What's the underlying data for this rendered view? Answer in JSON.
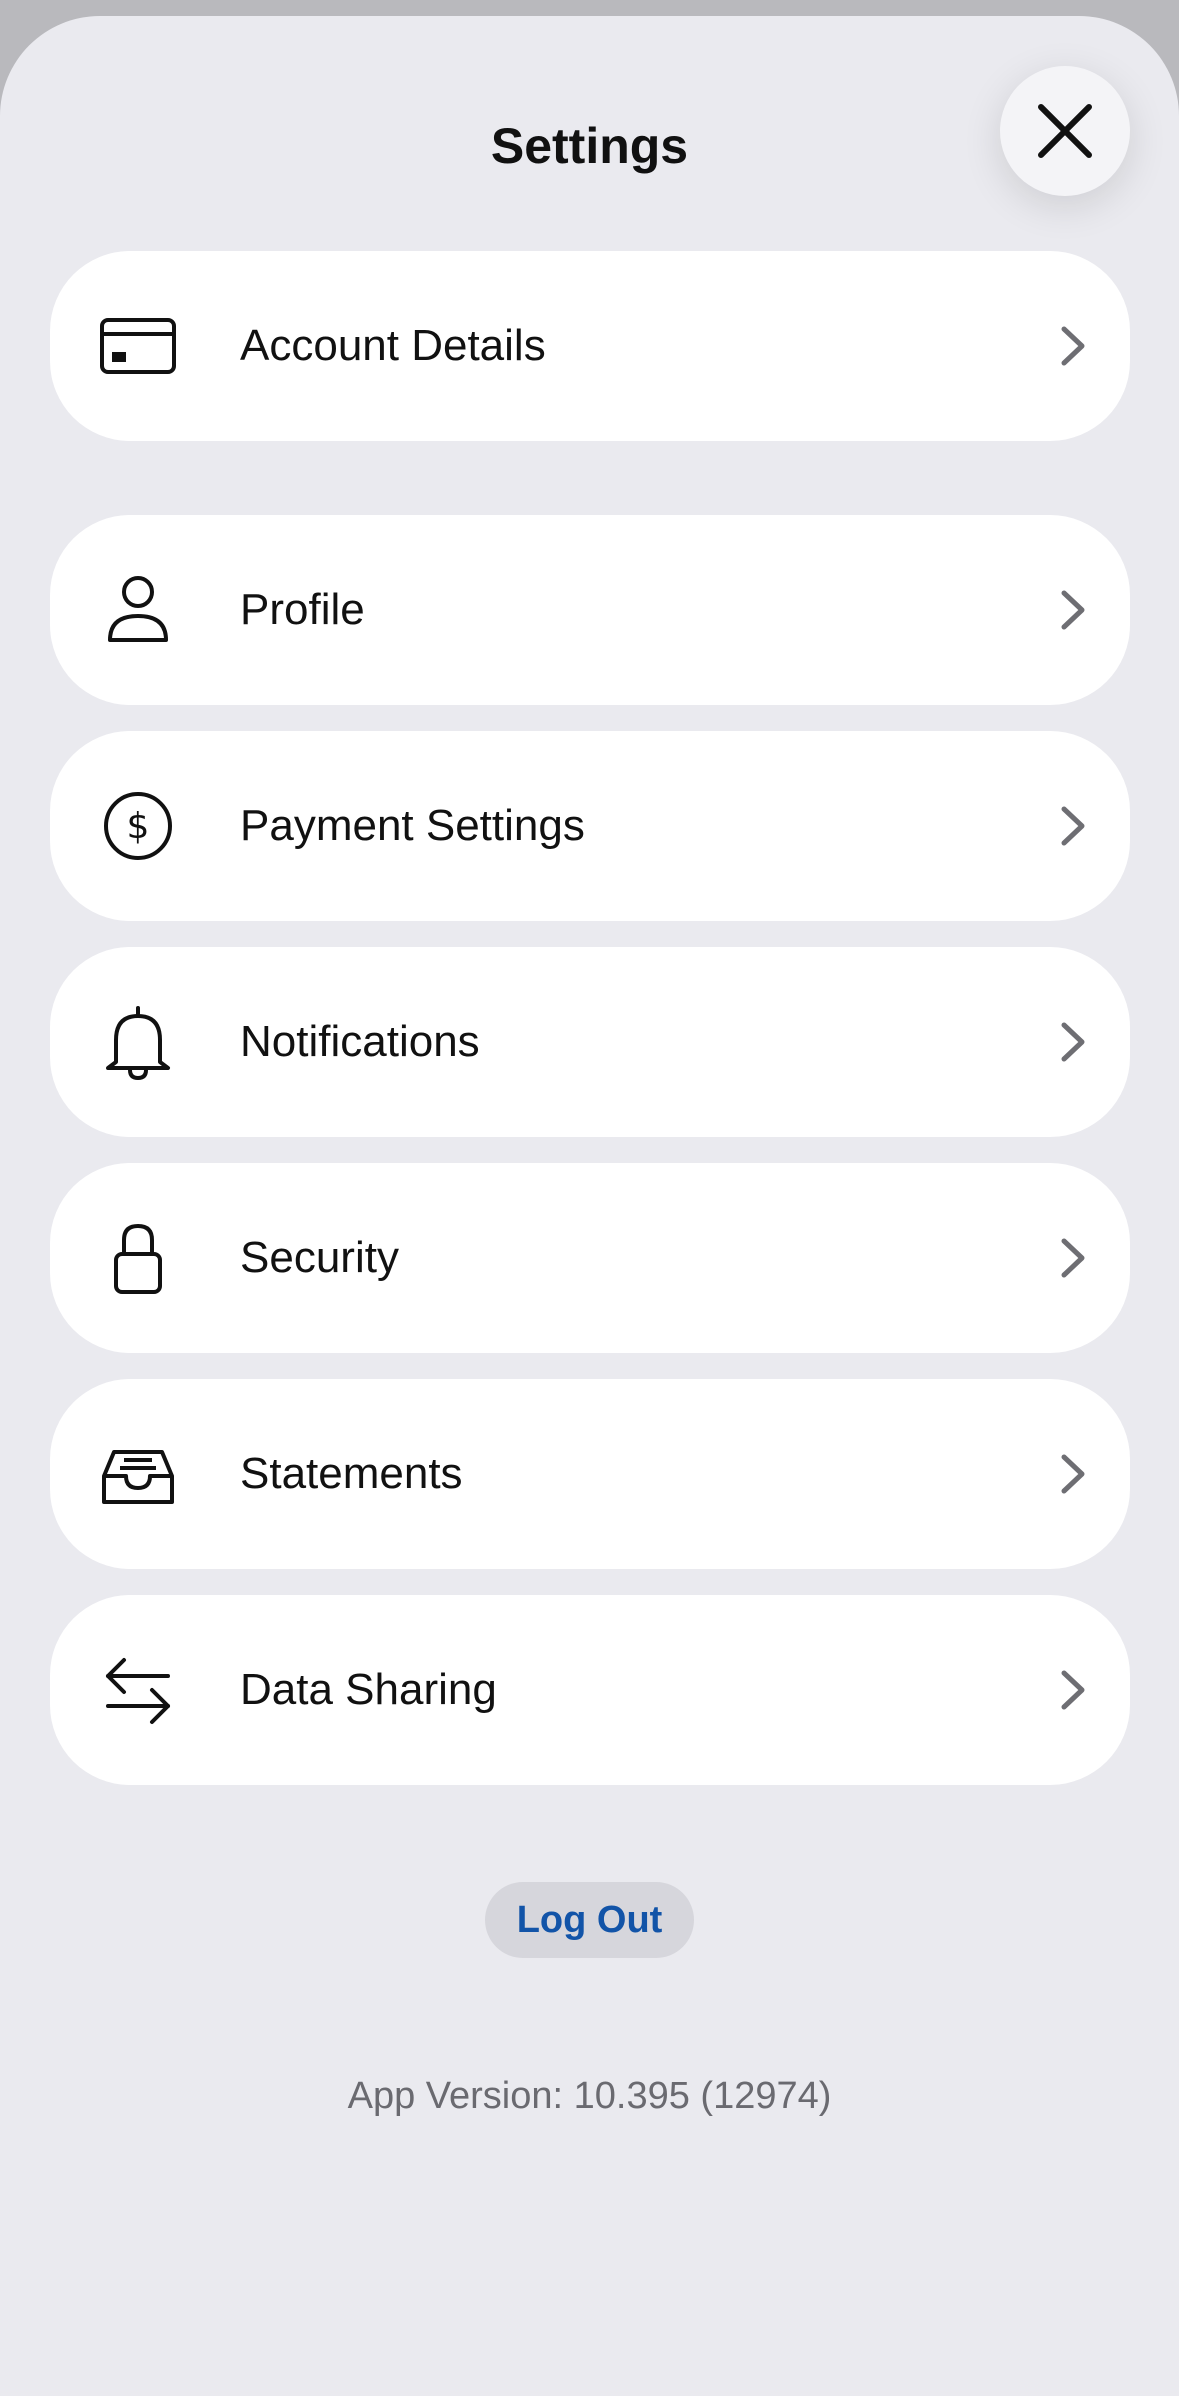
{
  "header": {
    "title": "Settings",
    "close_icon": "close-icon"
  },
  "menu": {
    "items": [
      {
        "label": "Account Details",
        "icon": "credit-card-icon"
      },
      {
        "label": "Profile",
        "icon": "person-icon"
      },
      {
        "label": "Payment Settings",
        "icon": "dollar-circle-icon"
      },
      {
        "label": "Notifications",
        "icon": "bell-icon"
      },
      {
        "label": "Security",
        "icon": "lock-icon"
      },
      {
        "label": "Statements",
        "icon": "inbox-tray-icon"
      },
      {
        "label": "Data Sharing",
        "icon": "arrows-swap-icon"
      }
    ],
    "chevron_icon": "chevron-right-icon"
  },
  "footer": {
    "logout_label": "Log Out",
    "version_text": "App Version: 10.395 (12974)"
  },
  "colors": {
    "background": "#eaeaef",
    "card": "#ffffff",
    "accent": "#1254a8",
    "logout_bg": "#d6d6dc",
    "muted_text": "#6a6a70"
  }
}
